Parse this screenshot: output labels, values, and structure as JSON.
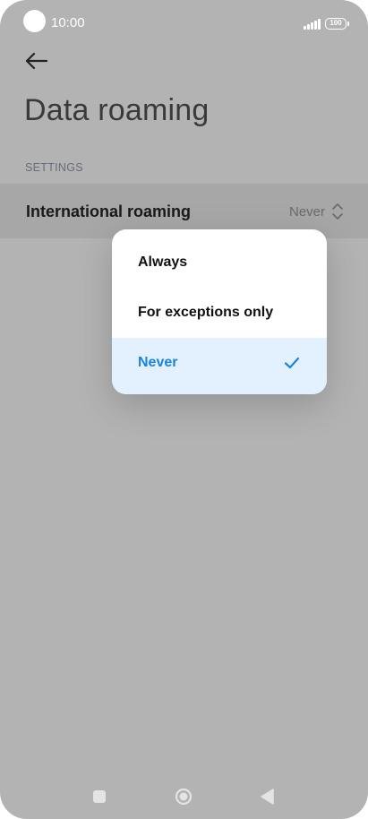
{
  "status_bar": {
    "time": "10:00",
    "battery": "100"
  },
  "header": {
    "title": "Data roaming"
  },
  "section": {
    "label": "SETTINGS"
  },
  "setting": {
    "label": "International roaming",
    "value": "Never"
  },
  "dropdown": {
    "options": [
      {
        "label": "Always",
        "selected": false
      },
      {
        "label": "For exceptions only",
        "selected": false
      },
      {
        "label": "Never",
        "selected": true
      }
    ]
  },
  "colors": {
    "accent": "#1a84e0",
    "selected_bg": "#e3f0fd",
    "scrim": "#b3b3b3"
  },
  "icons": [
    "back-arrow-icon",
    "chevron-updown-icon",
    "check-icon",
    "recents-icon",
    "home-icon",
    "back-triangle-icon"
  ]
}
